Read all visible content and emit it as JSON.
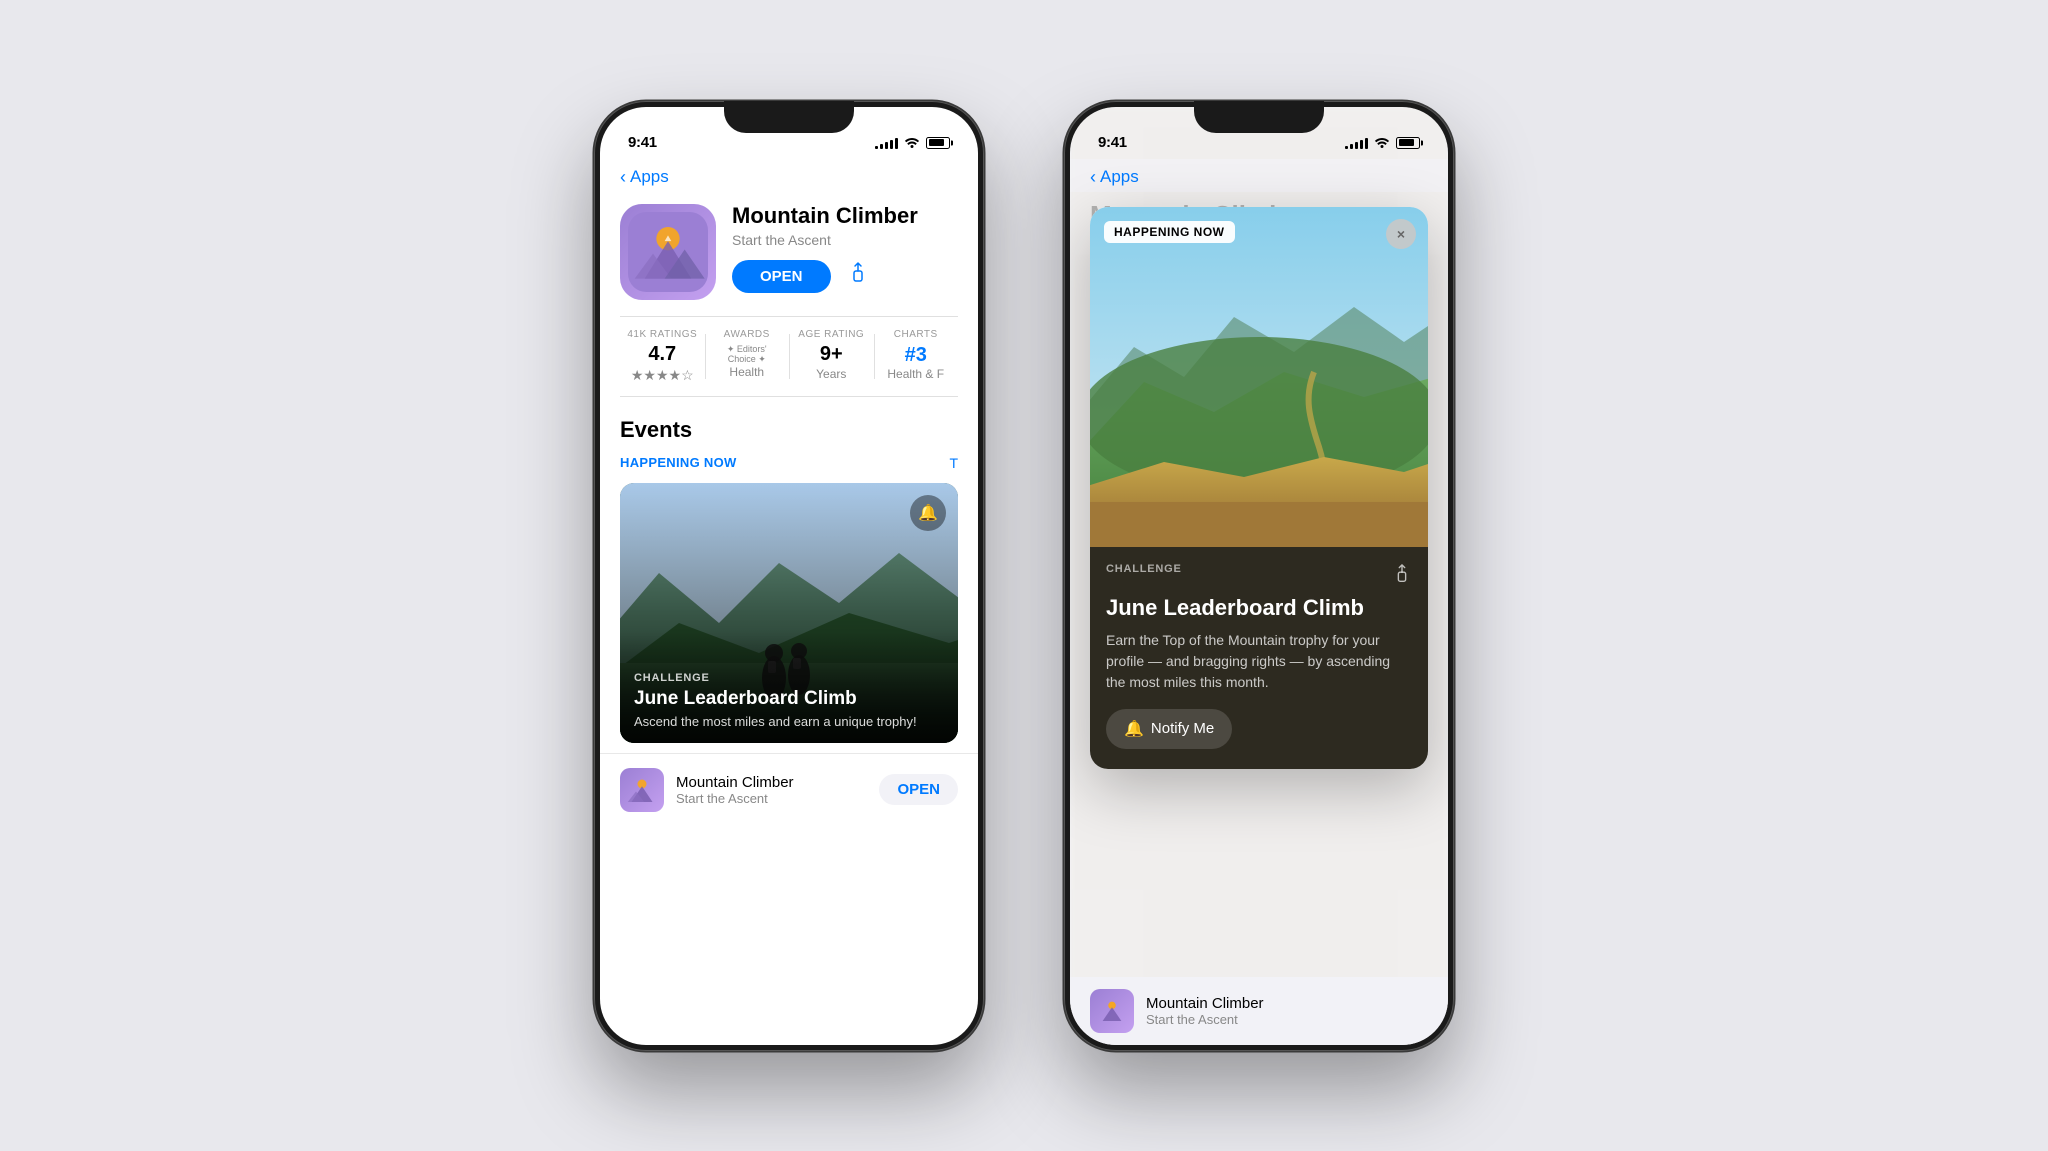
{
  "left_phone": {
    "status": {
      "time": "9:41",
      "signal": [
        3,
        5,
        7,
        9,
        11
      ],
      "battery_pct": 80
    },
    "nav": {
      "back_label": "Apps"
    },
    "app": {
      "name": "Mountain Climber",
      "tagline": "Start the Ascent",
      "open_btn": "OPEN"
    },
    "stats": [
      {
        "label": "41K RATINGS",
        "value": "4.7",
        "sub": "★★★★☆"
      },
      {
        "label": "AWARDS",
        "value": "Editors'",
        "sub": "Health"
      },
      {
        "label": "AGE RATING",
        "value": "9+",
        "sub": "Years"
      },
      {
        "label": "CHARTS",
        "value": "#3",
        "sub": "Health & F"
      }
    ],
    "events": {
      "title": "Events",
      "filter": "HAPPENING NOW",
      "see_all": "T",
      "card": {
        "type": "CHALLENGE",
        "name": "June Leaderboard Climb",
        "desc": "Ascend the most miles and earn a unique trophy!"
      }
    },
    "bottom_app": {
      "name": "Mountain Climber",
      "tagline": "Start the Ascent",
      "open_btn": "OPEN"
    }
  },
  "right_phone": {
    "status": {
      "time": "9:41"
    },
    "nav": {
      "back_label": "Apps"
    },
    "bg_app_name": "Mountain Climber",
    "modal": {
      "badge": "HAPPENING NOW",
      "close": "×",
      "event_type": "CHALLENGE",
      "event_name": "June Leaderboard Climb",
      "event_desc": "Earn the Top of the Mountain trophy for your profile — and bragging rights — by ascending the most miles this month.",
      "share_icon": "⬆",
      "notify_btn": "Notify Me"
    },
    "bottom_app": {
      "name": "Mountain Climber",
      "tagline": "Start the Ascent"
    }
  }
}
